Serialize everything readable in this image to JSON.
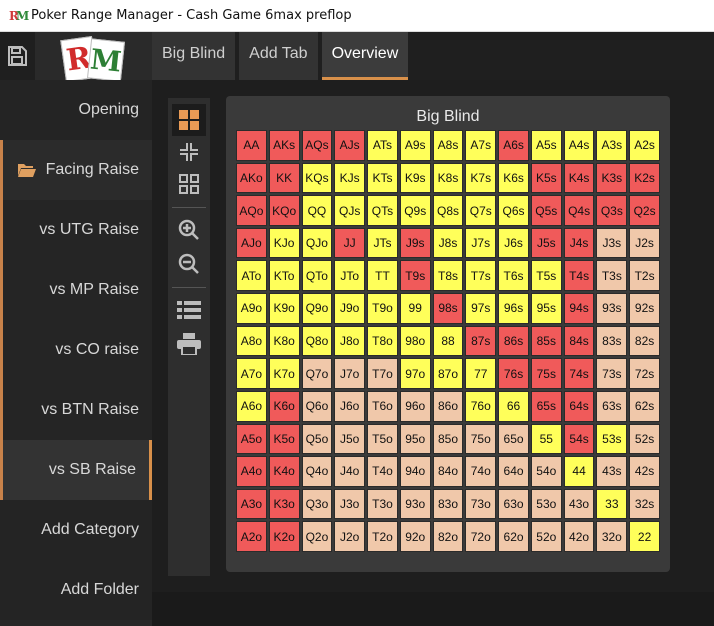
{
  "window": {
    "title": "Poker Range Manager - Cash Game 6max preflop",
    "icon_letters": [
      "R",
      "M"
    ]
  },
  "logo": {
    "letters": [
      "R",
      "M"
    ]
  },
  "tabs": [
    {
      "label": "Big Blind",
      "active": false
    },
    {
      "label": "Add Tab",
      "active": false
    },
    {
      "label": "Overview",
      "active": true
    }
  ],
  "sidebar": {
    "items": [
      {
        "label": "Opening"
      },
      {
        "label": "Facing Raise",
        "icon": "folder-open-icon"
      },
      {
        "label": "vs UTG Raise"
      },
      {
        "label": "vs MP Raise"
      },
      {
        "label": "vs CO raise"
      },
      {
        "label": "vs BTN Raise"
      },
      {
        "label": "vs SB Raise"
      },
      {
        "label": "Add Category"
      },
      {
        "label": "Add Folder"
      }
    ]
  },
  "tools": [
    "grid-large-icon",
    "grid-collapse-icon",
    "grid-small-icon",
    "zoom-in-icon",
    "zoom-out-icon",
    "list-icon",
    "print-icon"
  ],
  "colors": {
    "red": "#f05a5a",
    "yellow": "#ffff5a",
    "tan": "#f0c8aa",
    "accent": "#d8904a"
  },
  "panel": {
    "title": "Big Blind",
    "rows": [
      [
        "AA:R",
        "AKs:R",
        "AQs:R",
        "AJs:R",
        "ATs:Y",
        "A9s:Y",
        "A8s:Y",
        "A7s:Y",
        "A6s:R",
        "A5s:Y",
        "A4s:Y",
        "A3s:Y",
        "A2s:Y"
      ],
      [
        "AKo:R",
        "KK:R",
        "KQs:Y",
        "KJs:Y",
        "KTs:Y",
        "K9s:Y",
        "K8s:Y",
        "K7s:Y",
        "K6s:Y",
        "K5s:R",
        "K4s:R",
        "K3s:R",
        "K2s:R"
      ],
      [
        "AQo:R",
        "KQo:R",
        "QQ:Y",
        "QJs:Y",
        "QTs:Y",
        "Q9s:Y",
        "Q8s:Y",
        "Q7s:Y",
        "Q6s:Y",
        "Q5s:R",
        "Q4s:R",
        "Q3s:R",
        "Q2s:R"
      ],
      [
        "AJo:R",
        "KJo:Y",
        "QJo:Y",
        "JJ:R",
        "JTs:Y",
        "J9s:R",
        "J8s:Y",
        "J7s:Y",
        "J6s:Y",
        "J5s:R",
        "J4s:R",
        "J3s:T",
        "J2s:T"
      ],
      [
        "ATo:Y",
        "KTo:Y",
        "QTo:Y",
        "JTo:Y",
        "TT:Y",
        "T9s:R",
        "T8s:Y",
        "T7s:Y",
        "T6s:Y",
        "T5s:Y",
        "T4s:R",
        "T3s:T",
        "T2s:T"
      ],
      [
        "A9o:Y",
        "K9o:Y",
        "Q9o:Y",
        "J9o:Y",
        "T9o:Y",
        "99:Y",
        "98s:R",
        "97s:Y",
        "96s:Y",
        "95s:Y",
        "94s:R",
        "93s:T",
        "92s:T"
      ],
      [
        "A8o:Y",
        "K8o:Y",
        "Q8o:Y",
        "J8o:Y",
        "T8o:Y",
        "98o:Y",
        "88:Y",
        "87s:R",
        "86s:R",
        "85s:R",
        "84s:R",
        "83s:T",
        "82s:T"
      ],
      [
        "A7o:Y",
        "K7o:Y",
        "Q7o:T",
        "J7o:T",
        "T7o:T",
        "97o:Y",
        "87o:Y",
        "77:Y",
        "76s:R",
        "75s:R",
        "74s:R",
        "73s:T",
        "72s:T"
      ],
      [
        "A6o:Y",
        "K6o:R",
        "Q6o:T",
        "J6o:T",
        "T6o:T",
        "96o:T",
        "86o:T",
        "76o:Y",
        "66:Y",
        "65s:R",
        "64s:R",
        "63s:T",
        "62s:T"
      ],
      [
        "A5o:R",
        "K5o:R",
        "Q5o:T",
        "J5o:T",
        "T5o:T",
        "95o:T",
        "85o:T",
        "75o:T",
        "65o:T",
        "55:Y",
        "54s:R",
        "53s:Y",
        "52s:T"
      ],
      [
        "A4o:R",
        "K4o:R",
        "Q4o:T",
        "J4o:T",
        "T4o:T",
        "94o:T",
        "84o:T",
        "74o:T",
        "64o:T",
        "54o:T",
        "44:Y",
        "43s:T",
        "42s:T"
      ],
      [
        "A3o:R",
        "K3o:R",
        "Q3o:T",
        "J3o:T",
        "T3o:T",
        "93o:T",
        "83o:T",
        "73o:T",
        "63o:T",
        "53o:T",
        "43o:T",
        "33:Y",
        "32s:T"
      ],
      [
        "A2o:R",
        "K2o:R",
        "Q2o:T",
        "J2o:T",
        "T2o:T",
        "92o:T",
        "82o:T",
        "72o:T",
        "62o:T",
        "52o:T",
        "42o:T",
        "32o:T",
        "22:Y"
      ]
    ]
  }
}
